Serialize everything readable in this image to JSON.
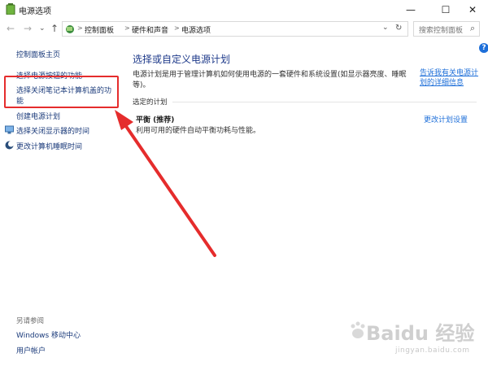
{
  "window": {
    "title": "电源选项",
    "minimize": "—",
    "maximize": "☐",
    "close": "✕"
  },
  "nav": {
    "back": "←",
    "forward": "→",
    "dropdown": "⌄",
    "up": "↑",
    "breadcrumbs": [
      "控制面板",
      "硬件和声音",
      "电源选项"
    ],
    "breadcrumb_sep": ">",
    "address_dropdown": "⌄",
    "refresh": "↻",
    "search_placeholder": "搜索控制面板",
    "search_icon": "⌕"
  },
  "help_label": "?",
  "sidebar": {
    "items": [
      {
        "label": "控制面板主页"
      },
      {
        "label": "选择电源按钮的功能"
      },
      {
        "label_line1": "选择关闭笔记本计算机盖的功",
        "label_line2": "能"
      },
      {
        "label": "创建电源计划"
      },
      {
        "label": "选择关闭显示器的时间",
        "icon": "monitor-icon"
      },
      {
        "label": "更改计算机睡眠时间",
        "icon": "moon-icon"
      }
    ],
    "see_also": "另请参阅",
    "see_also_items": [
      "Windows 移动中心",
      "用户帐户"
    ]
  },
  "main": {
    "title": "选择或自定义电源计划",
    "description": "电源计划是用于管理计算机如何使用电源的一套硬件和系统设置(如显示器亮度、睡眠等)。",
    "desc_link_line1": "告诉我有关电源计",
    "desc_link_line2": "划的详细信息",
    "section_label": "选定的计划",
    "plan_name": "平衡 (推荐)",
    "plan_description": "利用可用的硬件自动平衡功耗与性能。",
    "plan_settings_link": "更改计划设置"
  },
  "watermark": {
    "main": "Baidu 经验",
    "sub": "jingyan.baidu.com"
  },
  "colors": {
    "highlight": "#e52c2c",
    "link": "#1e6fd9",
    "title": "#1e3a8a"
  }
}
